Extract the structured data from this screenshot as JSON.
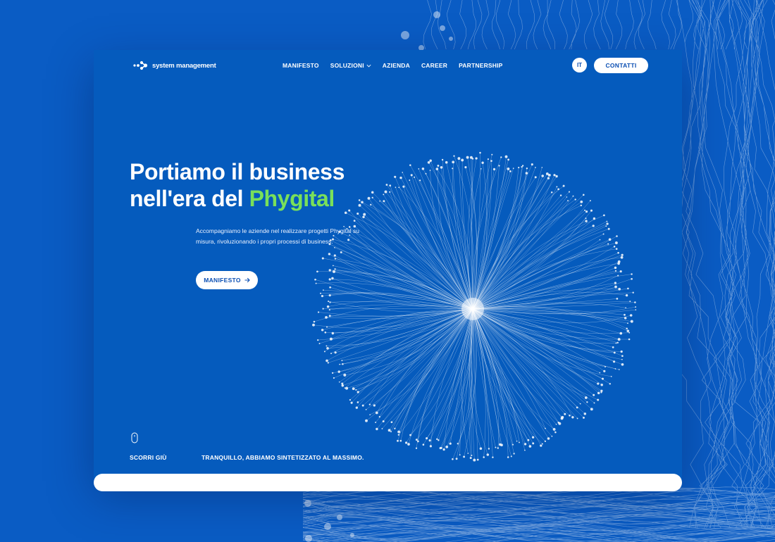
{
  "colors": {
    "background": "#0a5cc4",
    "panel": "#055bbd",
    "accent_green": "#79e05a",
    "button_text": "#0b4fb3",
    "white": "#ffffff"
  },
  "header": {
    "logo_text": "system management",
    "logo_icon": "dots-arrow-logo-icon",
    "nav": [
      "MANIFESTO",
      "SOLUZIONI",
      "AZIENDA",
      "CAREER",
      "PARTNERSHIP"
    ],
    "dropdown_icon": "chevron-down-icon",
    "language": "IT",
    "contact_label": "CONTATTI"
  },
  "hero": {
    "title_line1": "Portiamo il business",
    "title_line2_prefix": "nell'era del ",
    "title_highlight": "Phygital",
    "subtitle": "Accompagniamo le aziende nel realizzare progetti Phygital su misura, rivoluzionando i propri processi di business.",
    "cta_label": "MANIFESTO",
    "cta_icon": "arrow-right-icon"
  },
  "footer": {
    "scroll_icon": "mouse-icon",
    "scroll_label": "SCORRI GIÙ",
    "tagline": "TRANQUILLO, ABBIAMO SINTETIZZATO AL MASSIMO."
  }
}
